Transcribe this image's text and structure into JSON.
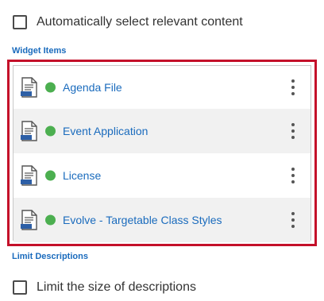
{
  "auto_select": {
    "label": "Automatically select relevant content",
    "checked": false
  },
  "widget_items": {
    "heading": "Widget Items",
    "items": [
      {
        "label": "Agenda File",
        "status": "active",
        "icon": "html-file-icon"
      },
      {
        "label": "Event Application",
        "status": "active",
        "icon": "html-file-icon"
      },
      {
        "label": "License",
        "status": "active",
        "icon": "html-file-icon"
      },
      {
        "label": "Evolve - Targetable Class Styles",
        "status": "active",
        "icon": "html-file-icon"
      }
    ]
  },
  "limit_descriptions": {
    "heading": "Limit Descriptions",
    "label": "Limit the size of descriptions",
    "checked": false
  },
  "colors": {
    "accent_blue": "#1a6bbd",
    "highlight_red": "#c4102a",
    "status_green": "#4caf50",
    "row_shade": "#f1f1f1"
  }
}
